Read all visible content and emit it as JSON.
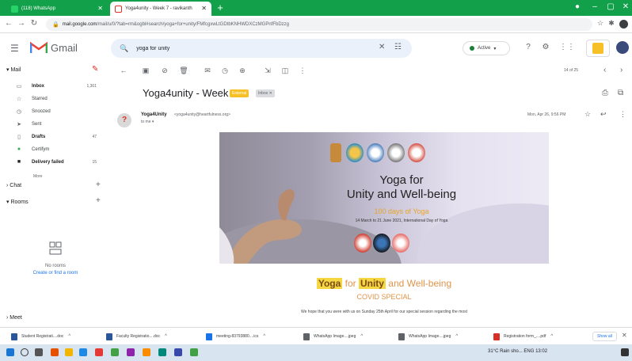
{
  "browser": {
    "tabs": [
      {
        "title": "(118) WhatsApp"
      },
      {
        "title": "Yoga4unity - Week 7 - ravikanth"
      }
    ],
    "address": {
      "host": "mail.google.com",
      "path": "/mail/u/0/?tab=rm&ogbl#search/yoga+for+unity/FMfcgxwLtGDtbKNHWDXCzMGPnfFbDzzg"
    }
  },
  "gmail": {
    "logo_text": "Gmail",
    "search": {
      "value": "yoga for unity"
    },
    "status": "Active",
    "sidebar": {
      "mail_title": "Mail",
      "items": [
        {
          "label": "Inbox",
          "count": "1,301",
          "icon": "inbox-icon",
          "bold": true
        },
        {
          "label": "Starred",
          "count": "",
          "icon": "star-icon",
          "bold": false
        },
        {
          "label": "Snoozed",
          "count": "",
          "icon": "clock-icon",
          "bold": false
        },
        {
          "label": "Sent",
          "count": "",
          "icon": "send-icon",
          "bold": false
        },
        {
          "label": "Drafts",
          "count": "47",
          "icon": "draft-icon",
          "bold": true
        },
        {
          "label": "Certifym",
          "count": "",
          "icon": "label-icon",
          "bold": false
        },
        {
          "label": "Delivery failed",
          "count": "15",
          "icon": "label-icon",
          "bold": true
        }
      ],
      "more": "More",
      "chat_title": "Chat",
      "rooms_title": "Rooms",
      "rooms_empty": "No rooms",
      "rooms_link": "Create or find a room",
      "meet_title": "Meet"
    },
    "pager": "14 of 25",
    "email": {
      "subject": "Yoga4unity - Week 7",
      "labels": [
        "External",
        "Inbox"
      ],
      "sender_initial": "?",
      "sender_name": "Yoga4Unity",
      "sender_email": "<yoga4unity@heartfulness.org>",
      "to": "to me",
      "date": "Mon, Apr 26, 9:56 PM",
      "banner": {
        "title_line1": "Yoga for",
        "title_line2": "Unity and Well-being",
        "days": "100 days of Yoga",
        "dates": "14 March to 21 June 2021, International Day of Yoga"
      },
      "heading": {
        "w1": "Yoga",
        "w2": " for ",
        "w3": "Unity",
        "w4": " and Well-being"
      },
      "subheading": "COVID SPECIAL",
      "body": "We hope that you were with us on Sunday 25th April for our special session regarding the most"
    }
  },
  "downloads": [
    {
      "name": "Student Registrati....doc",
      "color": "#2b579a"
    },
    {
      "name": "Faculty Registratio....doc",
      "color": "#2b579a"
    },
    {
      "name": "meeting-83793880....ics",
      "color": "#1a73e8"
    },
    {
      "name": "WhatsApp Image....jpeg",
      "color": "#5f6368"
    },
    {
      "name": "WhatsApp Image....jpeg",
      "color": "#5f6368"
    },
    {
      "name": "Registration form_....pdf",
      "color": "#d93025"
    }
  ],
  "downloads_show_all": "Show all",
  "taskbar": {
    "tray": "31°C Rain sho...  ENG  13:02"
  }
}
